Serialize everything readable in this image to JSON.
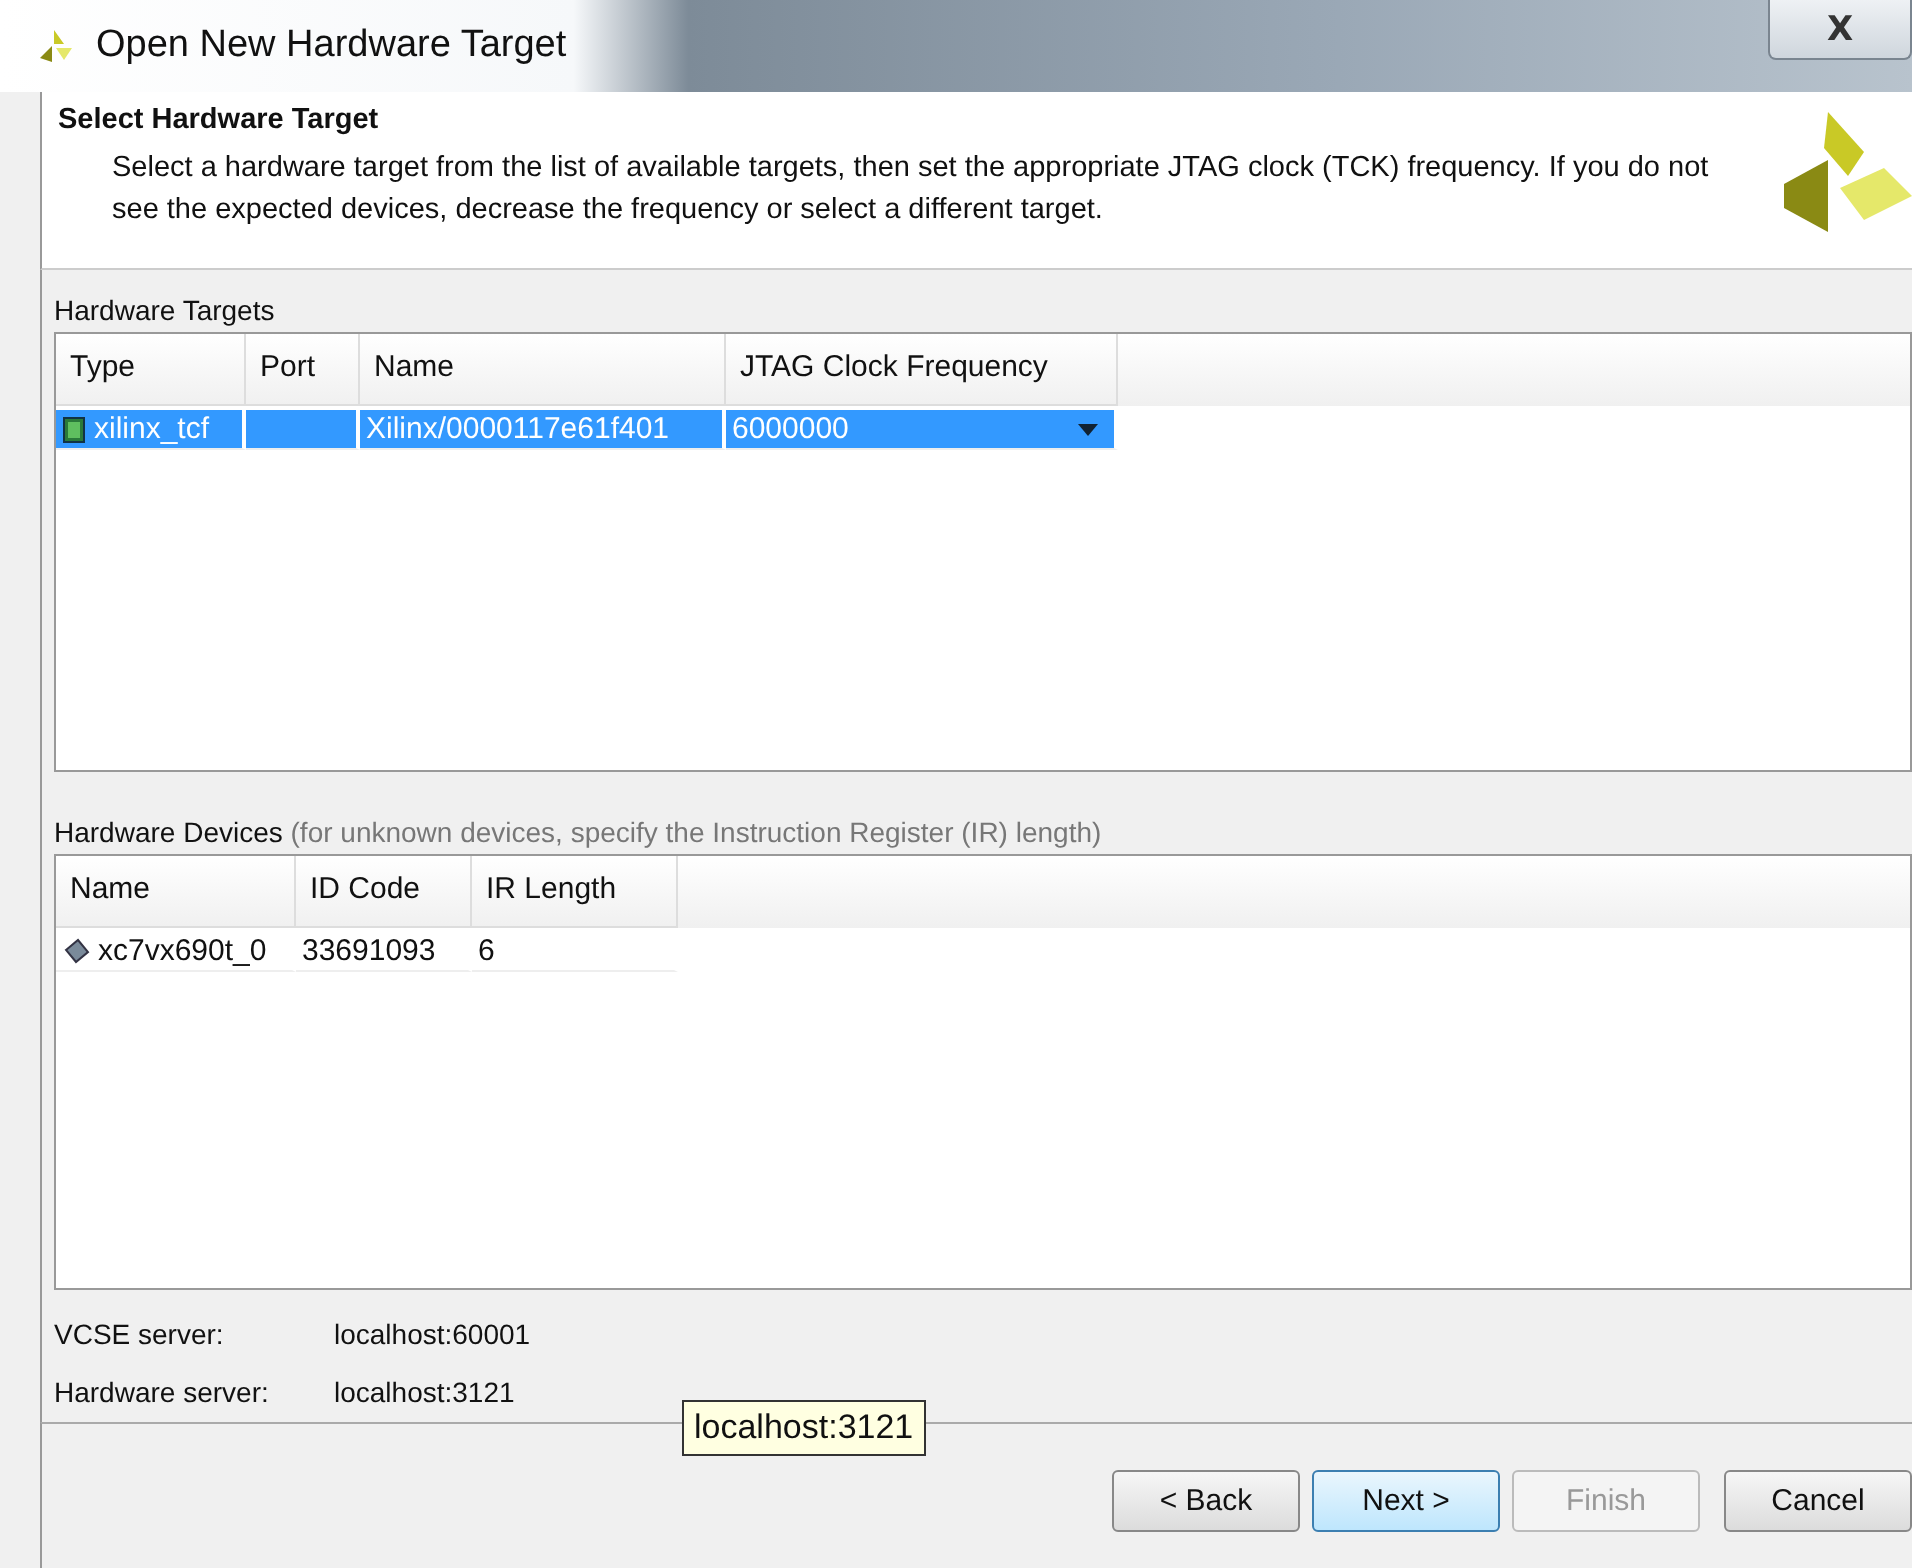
{
  "window": {
    "title": "Open New Hardware Target",
    "close": "X"
  },
  "header": {
    "title": "Select Hardware Target",
    "description": "Select a hardware target from the list of available targets, then set the appropriate JTAG clock (TCK) frequency. If you do not see the expected devices, decrease the frequency or select a different target."
  },
  "hardware_targets": {
    "label": "Hardware Targets",
    "columns": [
      "Type",
      "Port",
      "Name",
      "JTAG Clock Frequency"
    ],
    "rows": [
      {
        "cells": [
          "xilinx_tcf",
          "",
          "Xilinx/0000117e61f401",
          "6000000"
        ],
        "selected": true
      }
    ]
  },
  "hardware_devices": {
    "label": "Hardware Devices",
    "hint": "(for unknown devices, specify the Instruction Register (IR) length)",
    "columns": [
      "Name",
      "ID Code",
      "IR Length"
    ],
    "rows": [
      {
        "cells": [
          "xc7vx690t_0",
          "33691093",
          "6"
        ],
        "selected": false
      }
    ]
  },
  "servers": [
    {
      "label": "VCSE server:",
      "value": "localhost:60001"
    },
    {
      "label": "Hardware server:",
      "value": "localhost:3121"
    }
  ],
  "tooltip": "localhost:3121",
  "buttons": [
    {
      "label": "< Back",
      "kind": "normal",
      "disabled": false
    },
    {
      "label": "Next >",
      "kind": "default",
      "disabled": false
    },
    {
      "label": "Finish",
      "kind": "normal",
      "disabled": true
    },
    {
      "label": "Cancel",
      "kind": "normal",
      "disabled": false
    }
  ]
}
